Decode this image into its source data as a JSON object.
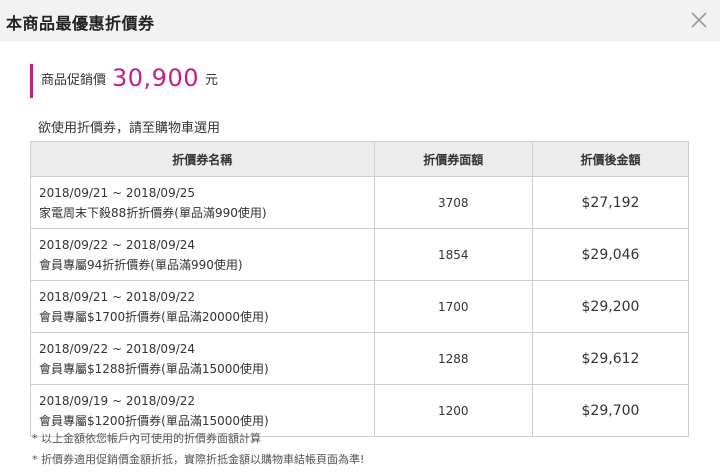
{
  "header": {
    "title": "本商品最優惠折價券"
  },
  "price": {
    "label": "商品促銷價",
    "value": "30,900",
    "unit": "元"
  },
  "instruction": "欲使用折價券，請至購物車選用",
  "table": {
    "headers": [
      "折價券名稱",
      "折價券面額",
      "折價後金額"
    ],
    "rows": [
      {
        "dates": "2018/09/21 ~ 2018/09/25",
        "name": "家電周末下殺88折折價券(單品滿990使用)",
        "amount": "3708",
        "final": "$27,192"
      },
      {
        "dates": "2018/09/22 ~ 2018/09/24",
        "name": "會員專屬94折折價券(單品滿990使用)",
        "amount": "1854",
        "final": "$29,046"
      },
      {
        "dates": "2018/09/21 ~ 2018/09/22",
        "name": "會員專屬$1700折價券(單品滿20000使用)",
        "amount": "1700",
        "final": "$29,200"
      },
      {
        "dates": "2018/09/22 ~ 2018/09/24",
        "name": "會員專屬$1288折價券(單品滿15000使用)",
        "amount": "1288",
        "final": "$29,612"
      },
      {
        "dates": "2018/09/19 ~ 2018/09/22",
        "name": "會員專屬$1200折價券(單品滿15000使用)",
        "amount": "1200",
        "final": "$29,700"
      }
    ]
  },
  "notes": [
    "* 以上金額依您帳戶內可使用的折價券面額計算",
    "* 折價券適用促銷價金額折抵，實際折抵金額以購物車結帳頁面為準!"
  ],
  "colors": {
    "accent": "#c41f85",
    "header_bg": "#f2f2f2",
    "table_head_bg": "#ececec"
  },
  "icons": {
    "close": "close-icon"
  }
}
